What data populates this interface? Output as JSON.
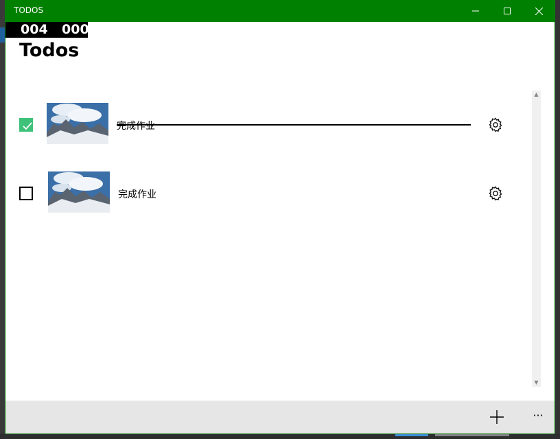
{
  "window": {
    "title": "TODOS",
    "accent_color": "#008000",
    "controls": [
      "minimize-icon",
      "maximize-icon",
      "close-icon"
    ]
  },
  "counter": {
    "left": "004",
    "right": "000"
  },
  "page": {
    "title": "Todos"
  },
  "todos": [
    {
      "text": "完成作业",
      "completed": true,
      "thumbnail": "mountain-image",
      "settings_icon": "gear-icon"
    },
    {
      "text": "完成作业",
      "completed": false,
      "thumbnail": "mountain-image",
      "settings_icon": "gear-icon"
    }
  ],
  "appbar": {
    "add_icon": "plus-icon",
    "more_label": "···"
  },
  "colors": {
    "checked": "#3ec27a",
    "appbar_bg": "#e6e6e6"
  }
}
